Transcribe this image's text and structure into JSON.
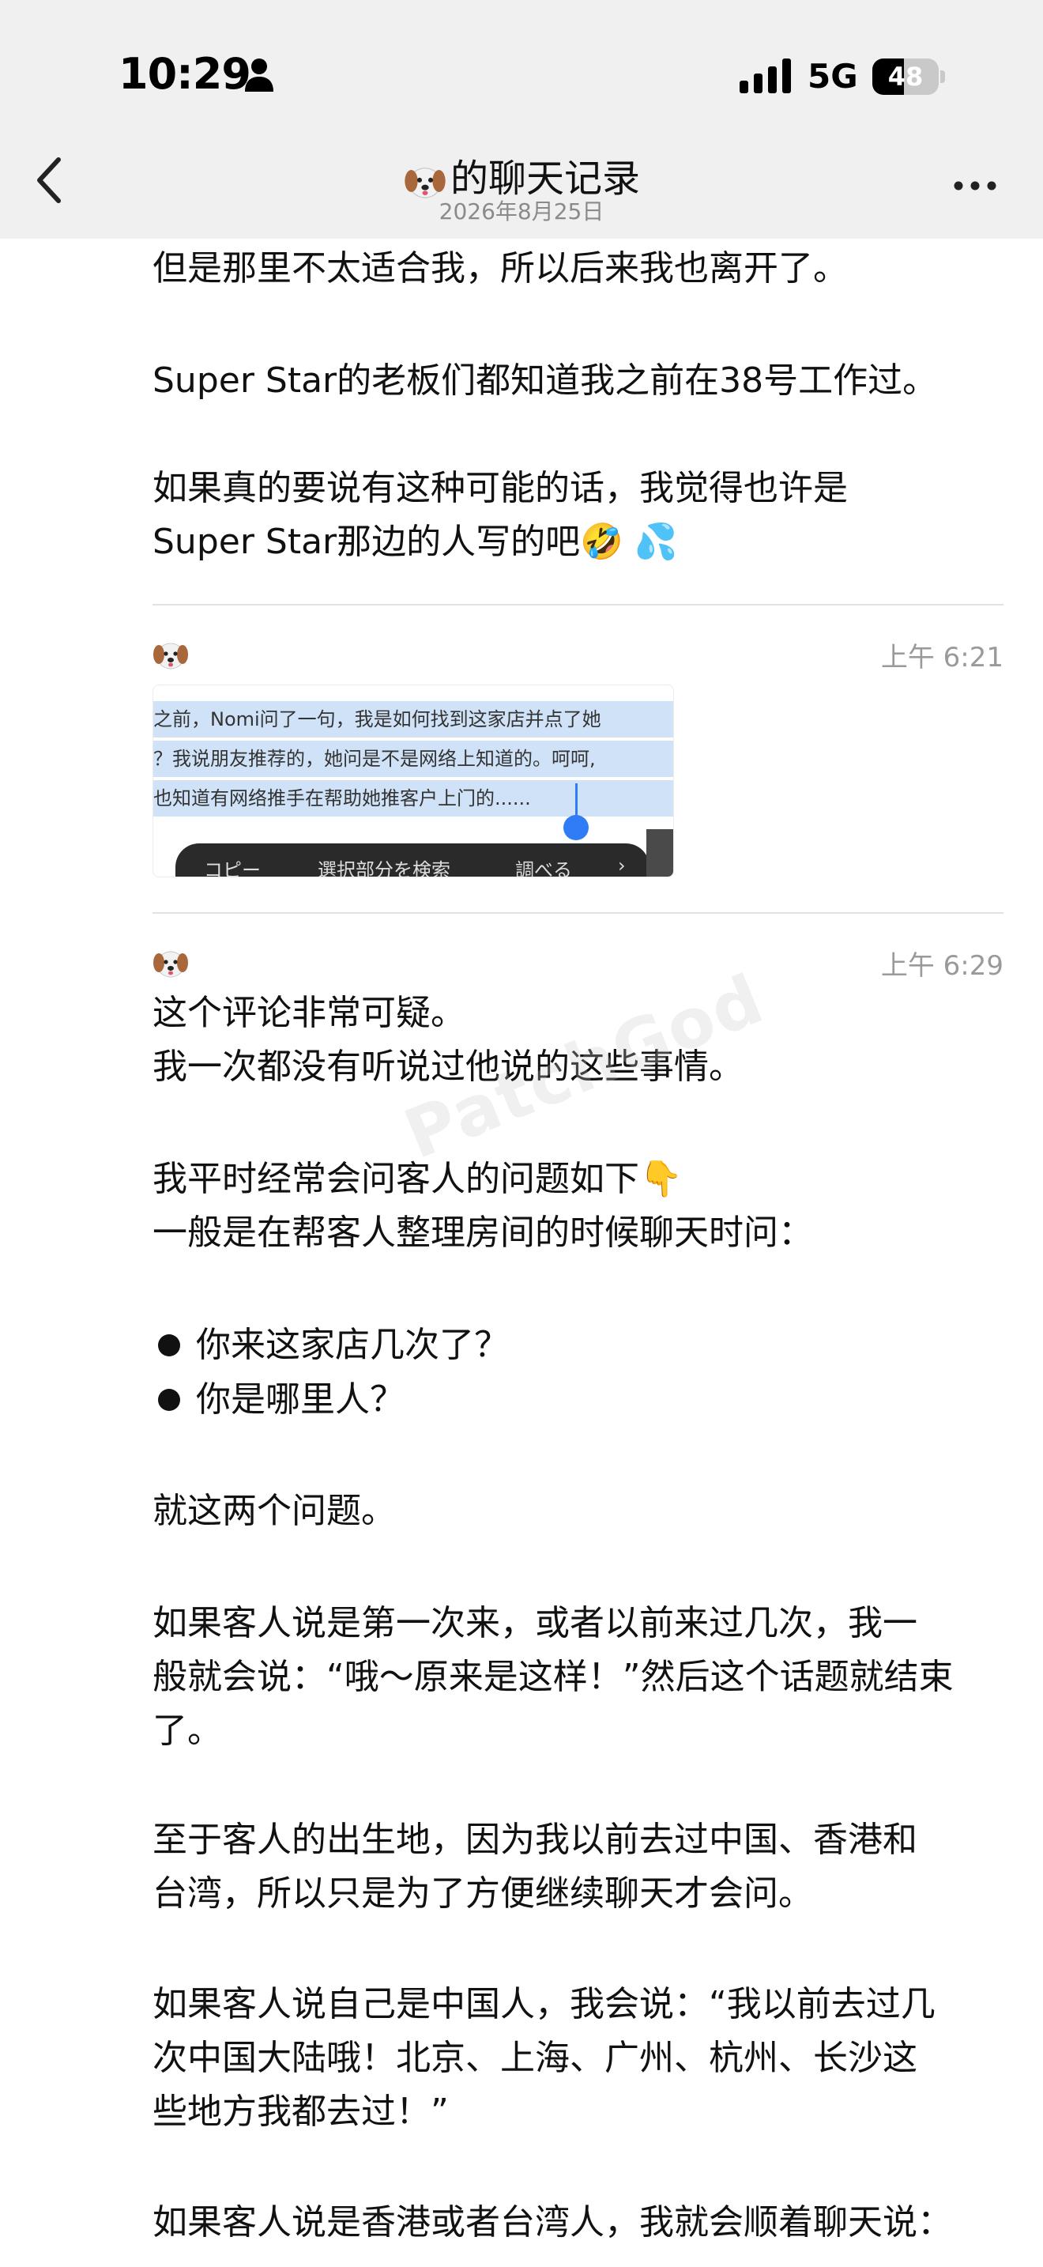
{
  "status_bar": {
    "time": "10:29",
    "network": "5G",
    "battery": "48",
    "battery_level": 0.48
  },
  "header": {
    "title": "的聊天记录",
    "date": "2026年8月25日"
  },
  "icons": {
    "back": "chevron-left-icon",
    "more": "more-dots-icon",
    "avatar": "dog-face-emoji",
    "person": "person-icon",
    "signal": "cellular-signal-icon",
    "battery": "battery-icon"
  },
  "messages": [
    {
      "paragraphs": [
        "但是那里不太适合我，所以后来我也离开了。",
        "Super Star的老板们都知道我之前在38号工作过。",
        "如果真的要说有这种可能的话，我觉得也许是",
        "Super Star那边的人写的吧🤣 💦"
      ]
    },
    {
      "time": "上午 6:21",
      "image": {
        "lines": [
          "之前，Nomi问了一句，我是如何找到这家店并点了她",
          "？我说朋友推荐的，她问是不是网络上知道的。呵呵,",
          "也知道有网络推手在帮助她推客户上门的......"
        ],
        "menu": [
          "コピー",
          "選択部分を検索",
          "調べる",
          "›"
        ]
      }
    },
    {
      "time": "上午 6:29",
      "lines": [
        "这个评论非常可疑。",
        "我一次都没有听说过他说的这些事情。",
        "我平时经常会问客人的问题如下👇",
        "一般是在帮客人整理房间的时候聊天时问：",
        "你来这家店几次了？",
        "你是哪里人？",
        "就这两个问题。",
        "如果客人说是第一次来，或者以前来过几次，我一",
        "般就会说：“哦～原来是这样！”然后这个话题就结束",
        "了。",
        "至于客人的出生地，因为我以前去过中国、香港和",
        "台湾，所以只是为了方便继续聊天才会问。",
        "如果客人说自己是中国人，我会说：“我以前去过几",
        "次中国大陆哦！北京、上海、广州、杭州、长沙这",
        "些地方我都去过！”",
        "如果客人说是香港或者台湾人，我就会顺着聊天说："
      ]
    }
  ],
  "watermark": "PatchGod"
}
